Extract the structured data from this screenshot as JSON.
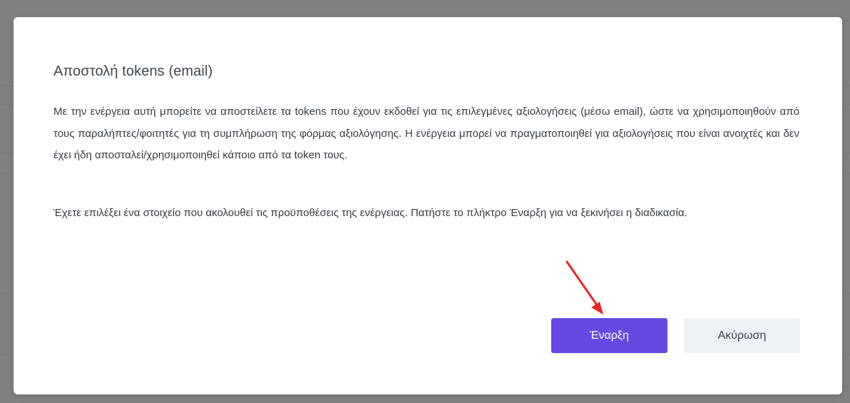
{
  "modal": {
    "title": "Αποστολή tokens (email)",
    "description": "Με την ενέργεια αυτή μπορείτε να αποστείλετε τα tokens που έχουν εκδοθεί για τις επιλεγμένες αξιολογήσεις (μέσω email), ώστε να χρησιμοποιηθούν από τους παραλήπτες/φοιτητές για τη συμπλήρωση της φόρμας αξιολόγησης. Η ενέργεια μπορεί να πραγματοποιηθεί για αξιολογήσεις που είναι ανοιχτές και δεν έχει ήδη αποσταλεί/χρησιμοποιηθεί κάποιο από τα token τους.",
    "note": "Έχετε επιλέξει ένα στοιχείο που ακολουθεί τις προϋποθέσεις της ενέργειας. Πατήστε το πλήκτρο Έναρξη για να ξεκινήσει η διαδικασία.",
    "start_label": "Έναρξη",
    "cancel_label": "Ακύρωση"
  },
  "colors": {
    "primary_button": "#6549e0",
    "secondary_button": "#eef1f5",
    "annotation_arrow": "#e8262b"
  },
  "annotation": {
    "icon": "red-arrow-icon"
  }
}
